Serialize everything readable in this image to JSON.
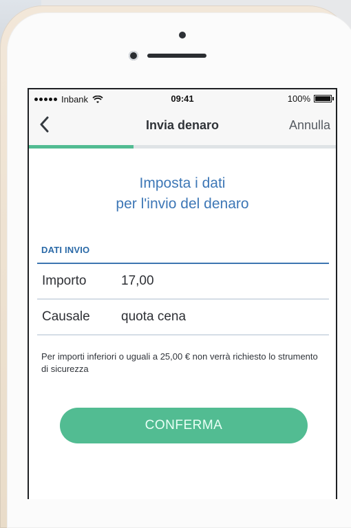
{
  "status_bar": {
    "carrier": "Inbank",
    "time": "09:41",
    "battery": "100%"
  },
  "nav": {
    "title": "Invia denaro",
    "cancel": "Annulla"
  },
  "progress": {
    "value": 0.34
  },
  "heading": {
    "line1": "Imposta i dati",
    "line2": "per l'invio del denaro"
  },
  "section": {
    "label": "DATI INVIO"
  },
  "fields": [
    {
      "label": "Importo",
      "value": "17,00"
    },
    {
      "label": "Causale",
      "value": "quota cena"
    }
  ],
  "info": {
    "text": "Per importi inferiori o uguali a 25,00 € non verrà richiesto lo strumento di sicurezza"
  },
  "confirm": {
    "label": "CONFERMA"
  }
}
